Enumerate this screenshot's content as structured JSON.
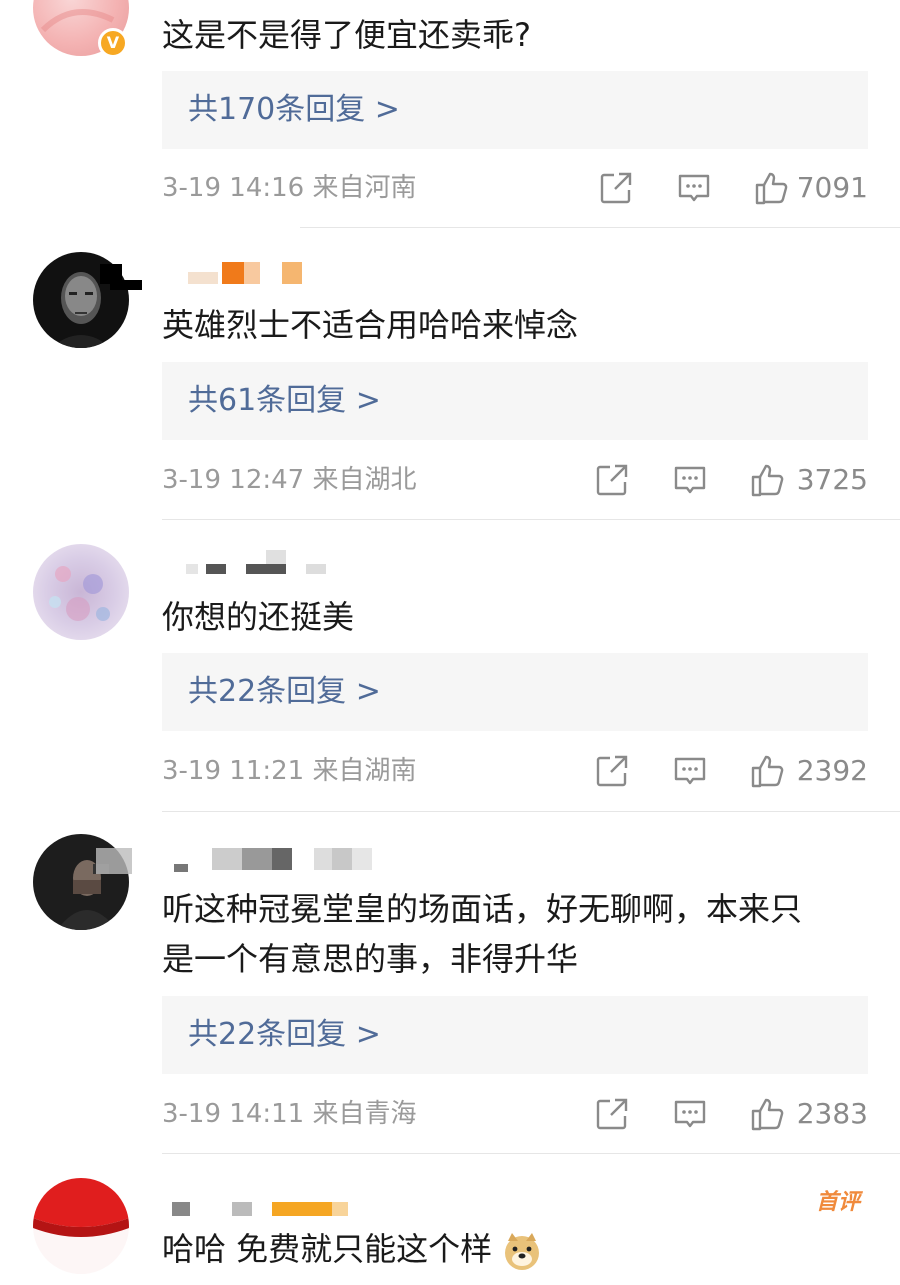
{
  "comments": [
    {
      "text": "这是不是得了便宜还卖乖?",
      "replies": "共170条回复 >",
      "time": "3-19 14:16",
      "location": "来自河南",
      "likes": "7091",
      "verified_badge": "V"
    },
    {
      "text": "英雄烈士不适合用哈哈来悼念",
      "replies": "共61条回复 >",
      "time": "3-19 12:47",
      "location": "来自湖北",
      "likes": "3725"
    },
    {
      "text": "你想的还挺美",
      "replies": "共22条回复 >",
      "time": "3-19 11:21",
      "location": "来自湖南",
      "likes": "2392"
    },
    {
      "text_line1": "听这种冠冕堂皇的场面话，好无聊啊，本来只",
      "text_line2": "是一个有意思的事，非得升华",
      "replies": "共22条回复 >",
      "time": "3-19 14:11",
      "location": "来自青海",
      "likes": "2383"
    },
    {
      "text": "哈哈 免费就只能这个样",
      "badge": "首评"
    }
  ],
  "icons": {
    "share": "share-icon",
    "comment": "comment-icon",
    "like": "thumbs-up-icon",
    "emoji": "doge-emoji-icon"
  },
  "colors": {
    "link_blue": "#506b98",
    "meta_gray": "#9a9a9a",
    "reply_bg": "#f6f6f6",
    "badge_orange": "#f08a3c"
  }
}
